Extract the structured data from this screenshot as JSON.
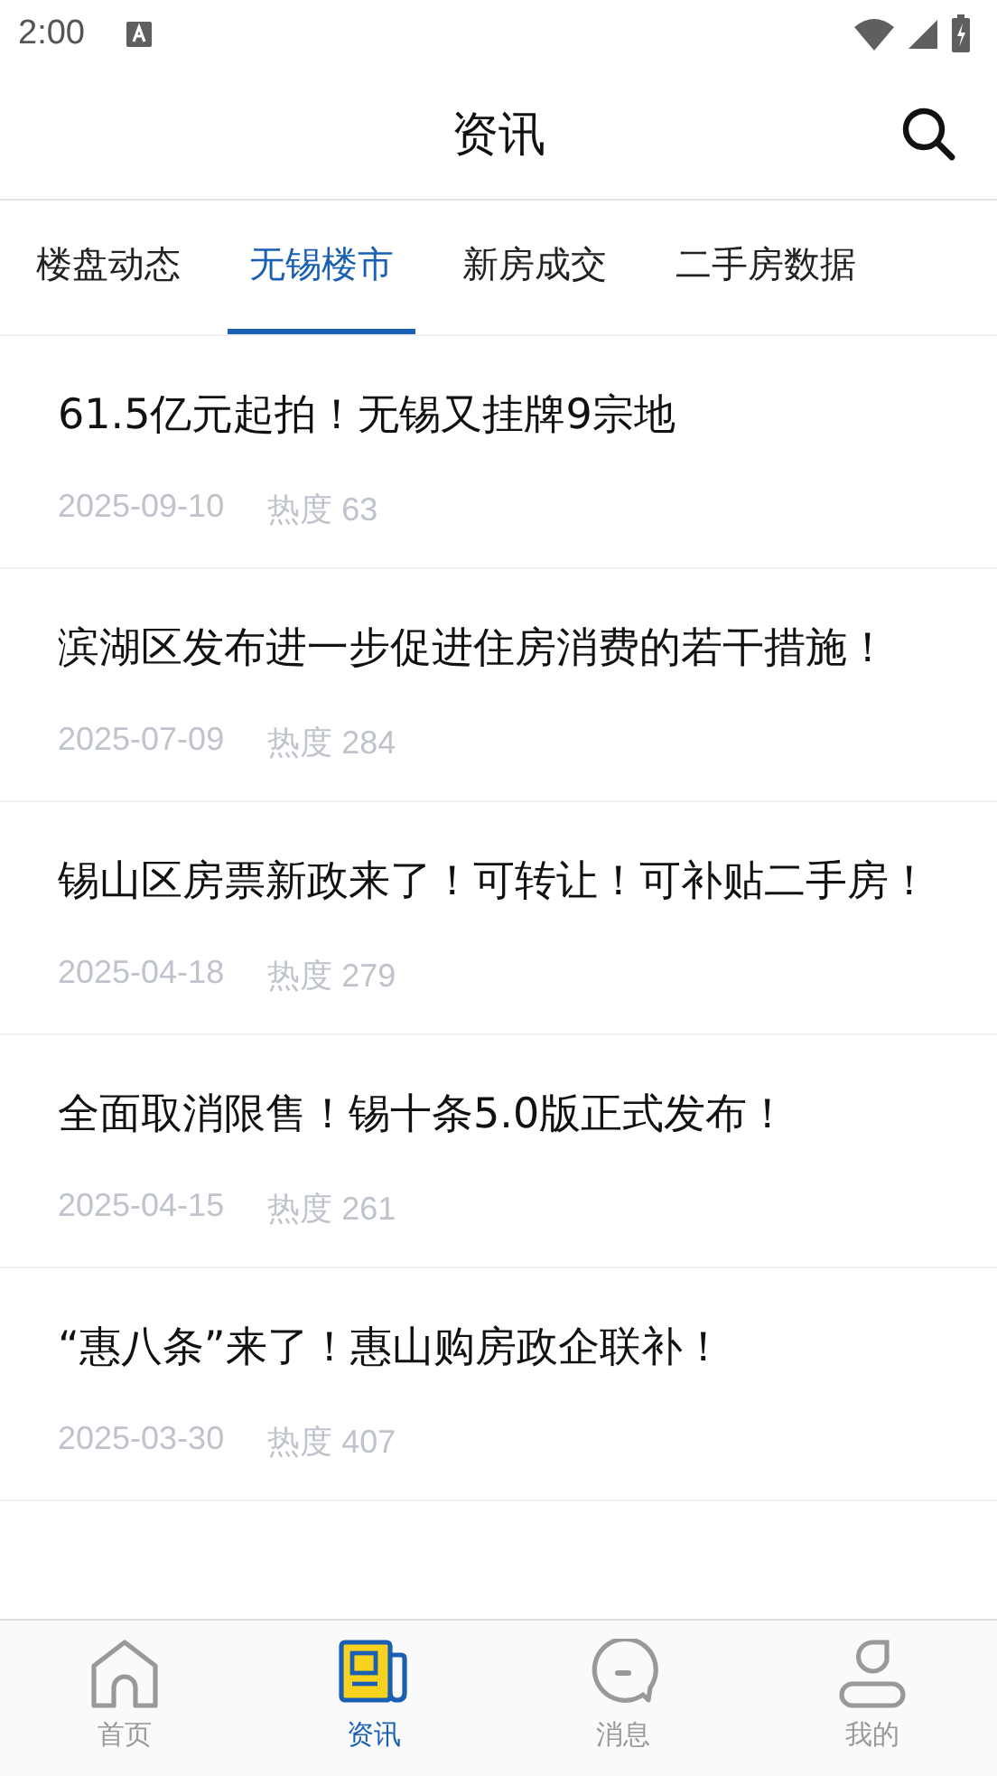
{
  "status_bar": {
    "time": "2:00"
  },
  "header": {
    "title": "资讯"
  },
  "tabs": [
    {
      "label": "楼盘动态",
      "selected": false
    },
    {
      "label": "无锡楼市",
      "selected": true
    },
    {
      "label": "新房成交",
      "selected": false
    },
    {
      "label": "二手房数据",
      "selected": false
    }
  ],
  "articles": [
    {
      "title": "61.5亿元起拍！无锡又挂牌9宗地",
      "date": "2025-09-10",
      "heat": "热度 63"
    },
    {
      "title": "滨湖区发布进一步促进住房消费的若干措施！",
      "date": "2025-07-09",
      "heat": "热度 284"
    },
    {
      "title": "锡山区房票新政来了！可转让！可补贴二手房！",
      "date": "2025-04-18",
      "heat": "热度 279"
    },
    {
      "title": "全面取消限售！锡十条5.0版正式发布！",
      "date": "2025-04-15",
      "heat": "热度 261"
    },
    {
      "title": "“惠八条”来了！惠山购房政企联补！",
      "date": "2025-03-30",
      "heat": "热度 407"
    }
  ],
  "bottom_nav": [
    {
      "label": "首页",
      "selected": false
    },
    {
      "label": "资讯",
      "selected": true
    },
    {
      "label": "消息",
      "selected": false
    },
    {
      "label": "我的",
      "selected": false
    }
  ]
}
